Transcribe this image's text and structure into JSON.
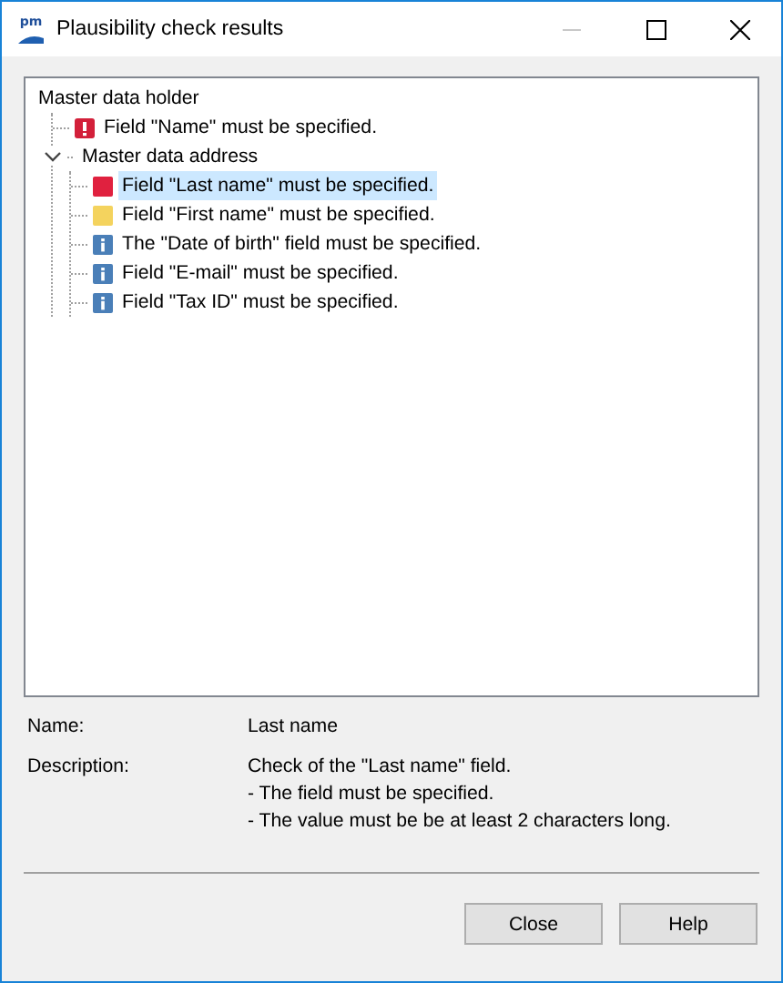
{
  "window": {
    "title": "Plausibility check results",
    "logo_text": "pm",
    "controls": [
      {
        "kind": "minimize",
        "disabled": true
      },
      {
        "kind": "maximize",
        "disabled": false
      },
      {
        "kind": "close",
        "disabled": false
      }
    ]
  },
  "tree": [
    {
      "label": "Master data holder",
      "children": [
        {
          "label": "Field \"Name\" must be specified.",
          "kind": "error-badge",
          "selected": false
        },
        {
          "label": "Master data address",
          "expanded": true,
          "children": [
            {
              "label": "Field \"Last name\" must be specified.",
              "kind": "error",
              "selected": true
            },
            {
              "label": "Field \"First name\" must be specified.",
              "kind": "warning",
              "selected": false
            },
            {
              "label": "The \"Date of birth\" field must be specified.",
              "kind": "info",
              "selected": false
            },
            {
              "label": "Field \"E-mail\" must be specified.",
              "kind": "info",
              "selected": false
            },
            {
              "label": "Field \"Tax ID\" must be specified.",
              "kind": "info",
              "selected": false
            }
          ]
        }
      ]
    }
  ],
  "details": [
    {
      "label": "Name:",
      "value": "Last name"
    },
    {
      "label": "Description:",
      "value": "Check of the \"Last name\" field.\n- The field must be specified.\n- The value must be be at least 2 characters long."
    }
  ],
  "buttons": [
    "Close",
    "Help"
  ]
}
